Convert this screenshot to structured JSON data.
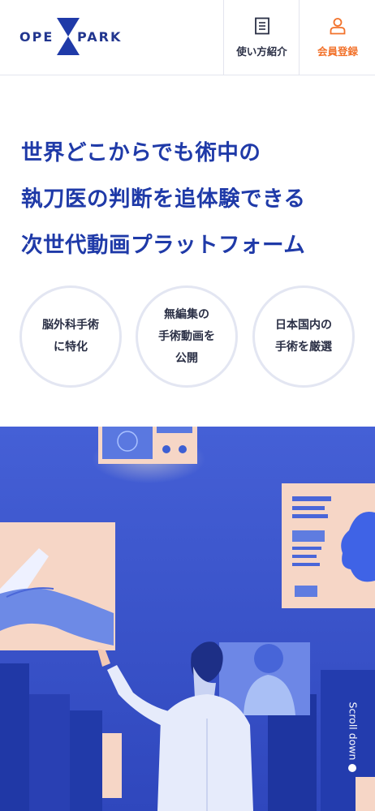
{
  "header": {
    "logo_left": "OPE",
    "logo_right": "PARK",
    "nav": [
      {
        "label": "使い方紹介",
        "icon": "document-icon"
      },
      {
        "label": "会員登録",
        "icon": "user-icon"
      }
    ]
  },
  "hero_copy": {
    "lines": [
      "世界どこからでも術中の",
      "執刀医の判断を追体験できる",
      "次世代動画プラットフォーム"
    ]
  },
  "features": [
    {
      "text": "脳外科手術\nに特化"
    },
    {
      "text": "無編集の\n手術動画を\n公開"
    },
    {
      "text": "日本国内の\n手術を厳選"
    }
  ],
  "scroll": {
    "label": "Scroll down"
  },
  "colors": {
    "brand_blue": "#1f3aa8",
    "accent_orange": "#f2722b",
    "illustration_blue": "#3c56cc",
    "panel_peach": "#f6d6c6"
  }
}
